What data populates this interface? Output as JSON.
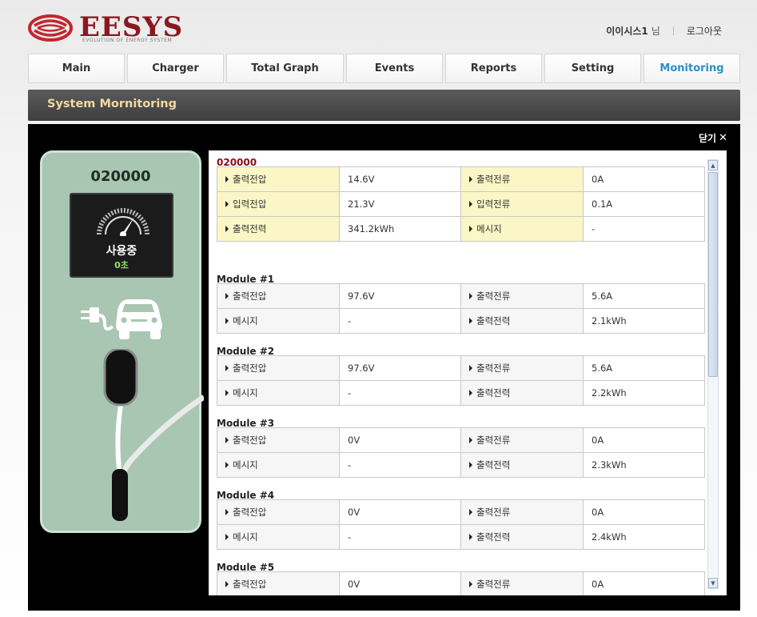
{
  "header": {
    "logo_text": "EESYS",
    "logo_tagline": "EVOLUTION OF ENERGY SYSTEM",
    "user_name": "이이시스1",
    "user_suffix": "님",
    "logout_label": "로그아웃"
  },
  "nav": {
    "tabs": [
      {
        "label": "Main",
        "active": false
      },
      {
        "label": "Charger",
        "active": false
      },
      {
        "label": "Total Graph",
        "active": false
      },
      {
        "label": "Events",
        "active": false
      },
      {
        "label": "Reports",
        "active": false
      },
      {
        "label": "Setting",
        "active": false
      },
      {
        "label": "Monitoring",
        "active": true
      }
    ]
  },
  "section": {
    "title": "System Mornitoring"
  },
  "panel": {
    "close_label": "닫기",
    "charger": {
      "id": "020000",
      "status": "사용중",
      "elapsed": "0초"
    },
    "summary": {
      "title": "020000",
      "rows": [
        [
          {
            "label": "출력전압",
            "value": "14.6V"
          },
          {
            "label": "출력전류",
            "value": "0A"
          }
        ],
        [
          {
            "label": "입력전압",
            "value": "21.3V"
          },
          {
            "label": "입력전류",
            "value": "0.1A"
          }
        ],
        [
          {
            "label": "출력전력",
            "value": "341.2kWh"
          },
          {
            "label": "메시지",
            "value": "-"
          }
        ]
      ]
    },
    "modules": [
      {
        "title": "Module #1",
        "rows": [
          [
            {
              "label": "출력전압",
              "value": "97.6V"
            },
            {
              "label": "출력전류",
              "value": "5.6A"
            }
          ],
          [
            {
              "label": "메시지",
              "value": "-"
            },
            {
              "label": "출력전력",
              "value": "2.1kWh"
            }
          ]
        ]
      },
      {
        "title": "Module #2",
        "rows": [
          [
            {
              "label": "출력전압",
              "value": "97.6V"
            },
            {
              "label": "출력전류",
              "value": "5.6A"
            }
          ],
          [
            {
              "label": "메시지",
              "value": "-"
            },
            {
              "label": "출력전력",
              "value": "2.2kWh"
            }
          ]
        ]
      },
      {
        "title": "Module #3",
        "rows": [
          [
            {
              "label": "출력전압",
              "value": "0V"
            },
            {
              "label": "출력전류",
              "value": "0A"
            }
          ],
          [
            {
              "label": "메시지",
              "value": "-"
            },
            {
              "label": "출력전력",
              "value": "2.3kWh"
            }
          ]
        ]
      },
      {
        "title": "Module #4",
        "rows": [
          [
            {
              "label": "출력전압",
              "value": "0V"
            },
            {
              "label": "출력전류",
              "value": "0A"
            }
          ],
          [
            {
              "label": "메시지",
              "value": "-"
            },
            {
              "label": "출력전력",
              "value": "2.4kWh"
            }
          ]
        ]
      },
      {
        "title": "Module #5",
        "rows": [
          [
            {
              "label": "출력전압",
              "value": "0V"
            },
            {
              "label": "출력전류",
              "value": "0A"
            }
          ]
        ]
      }
    ]
  }
}
